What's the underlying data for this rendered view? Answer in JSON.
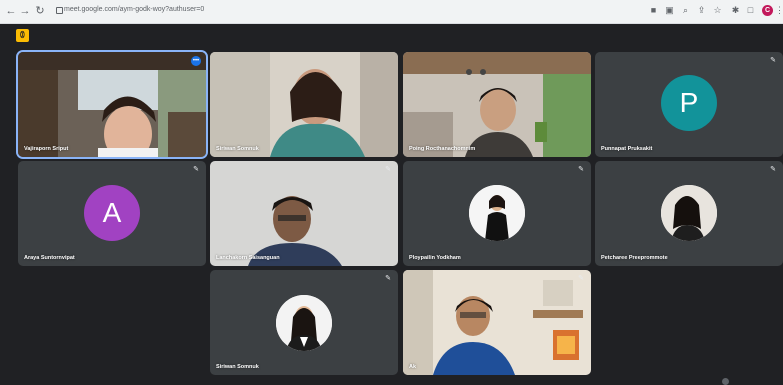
{
  "browser": {
    "url": "meet.google.com/aym-godk-woy?authuser=0",
    "profile_initial": "C"
  },
  "meet": {
    "badge": "ꀧ"
  },
  "participants": [
    {
      "name": "Vajiraporn Sriput",
      "type": "video",
      "speaking": true
    },
    {
      "name": "Siriwan Somnuk",
      "type": "video"
    },
    {
      "name": "Poing Rocthanachomnim",
      "type": "video"
    },
    {
      "name": "Punnapat Pruksakit",
      "type": "letter",
      "initial": "P",
      "color": "#12939a",
      "muted": true
    },
    {
      "name": "Araya Suntornvipat",
      "type": "letter",
      "initial": "A",
      "color": "#a142c2",
      "muted": true
    },
    {
      "name": "Lanchakorn Saisanguan",
      "type": "video",
      "muted": true
    },
    {
      "name": "Ploypailin Yodkham",
      "type": "photo",
      "muted": true
    },
    {
      "name": "Petcharee Preeprommote",
      "type": "photo",
      "muted": true
    },
    {
      "name": "Siriwan Somnuk",
      "type": "photo",
      "muted": true
    },
    {
      "name": "Ak",
      "type": "video",
      "muted": true
    }
  ]
}
